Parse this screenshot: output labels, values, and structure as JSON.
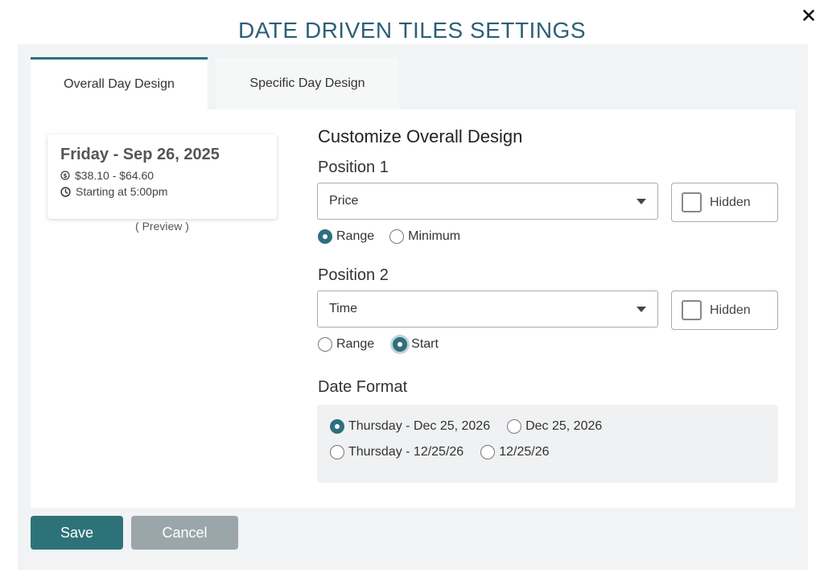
{
  "dialog": {
    "title": "DATE DRIVEN TILES SETTINGS",
    "close_icon": "close-icon"
  },
  "tabs": [
    {
      "label": "Overall Day Design",
      "active": true
    },
    {
      "label": "Specific Day Design",
      "active": false
    }
  ],
  "preview": {
    "date": "Friday - Sep 26, 2025",
    "price": "$38.10 - $64.60",
    "time": "Starting at 5:00pm",
    "caption": "( Preview )",
    "price_icon": "dollar-circle-icon",
    "time_icon": "clock-icon"
  },
  "customize": {
    "heading": "Customize Overall Design",
    "position1": {
      "label": "Position 1",
      "selected": "Price",
      "hidden_label": "Hidden",
      "hidden_checked": false,
      "options": [
        {
          "label": "Range",
          "checked": true
        },
        {
          "label": "Minimum",
          "checked": false
        }
      ]
    },
    "position2": {
      "label": "Position 2",
      "selected": "Time",
      "hidden_label": "Hidden",
      "hidden_checked": false,
      "options": [
        {
          "label": "Range",
          "checked": false
        },
        {
          "label": "Start",
          "checked": true
        }
      ]
    },
    "date_format": {
      "label": "Date Format",
      "options": [
        {
          "label": "Thursday - Dec 25, 2026",
          "checked": true
        },
        {
          "label": "Dec 25, 2026",
          "checked": false
        },
        {
          "label": "Thursday - 12/25/26",
          "checked": false
        },
        {
          "label": "12/25/26",
          "checked": false
        }
      ]
    }
  },
  "buttons": {
    "save": "Save",
    "cancel": "Cancel"
  },
  "colors": {
    "accent": "#2e6f7e",
    "title": "#2e5f77",
    "cancel": "#9ba6ab"
  }
}
